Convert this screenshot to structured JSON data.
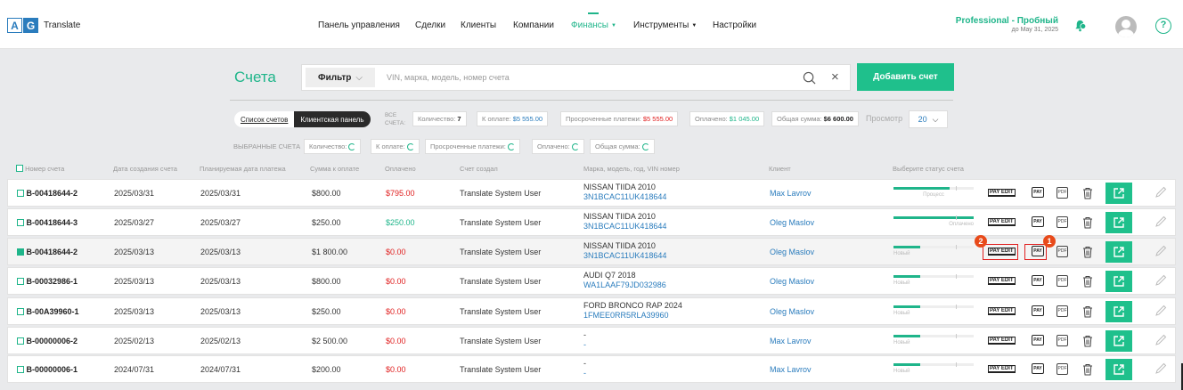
{
  "header": {
    "logo_letters": [
      "A",
      "G"
    ],
    "logo_word": "Translate",
    "nav": [
      {
        "label": "Панель управления",
        "active": false,
        "dropdown": false
      },
      {
        "label": "Сделки",
        "active": false,
        "dropdown": false
      },
      {
        "label": "Клиенты",
        "active": false,
        "dropdown": false
      },
      {
        "label": "Компании",
        "active": false,
        "dropdown": false
      },
      {
        "label": "Финансы",
        "active": true,
        "dropdown": true
      },
      {
        "label": "Инструменты",
        "active": false,
        "dropdown": true
      },
      {
        "label": "Настройки",
        "active": false,
        "dropdown": false
      }
    ],
    "plan_title": "Professional - Пробный",
    "plan_date": "до May 31, 2025",
    "help": "?"
  },
  "toolbar": {
    "title": "Счета",
    "filter_label": "Фильтр",
    "search_placeholder": "VIN, марка, модель, номер счета",
    "add_button": "Добавить счет"
  },
  "summary": {
    "tab_list": "Список счетов",
    "tab_client": "Клиентская панель",
    "all_label_1": "ВСЕ",
    "all_label_2": "СЧЕТА:",
    "count_label": "Количество:",
    "count_value": "7",
    "to_pay_label": "К оплате:",
    "to_pay_value": "$5 555.00",
    "overdue_label": "Просроченные платежи:",
    "overdue_value": "$5 555.00",
    "paid_label": "Оплачено:",
    "paid_value": "$1 045.00",
    "total_label": "Общая сумма:",
    "total_value": "$6 600.00",
    "view_label": "Просмотр",
    "view_value": "20",
    "selected_label": "ВЫБРАННЫЕ СЧЕТА",
    "sel_count": "Количество:",
    "sel_to_pay": "К оплате:",
    "sel_overdue": "Просроченные платежи:",
    "sel_paid": "Оплачено:",
    "sel_total": "Общая сумма:"
  },
  "table": {
    "columns": [
      "Номер счета",
      "Дата создания счета",
      "Планируемая дата платежа",
      "Сумма к оплате",
      "Оплачено",
      "Счет создал",
      "Марка, модель, год, VIN номер",
      "Клиент",
      "Выберите статус счета"
    ],
    "action_labels": {
      "pay_edit": "PAY EDIT",
      "pay": "PAY",
      "pdf": "PDF"
    },
    "rows": [
      {
        "number": "B-00418644-2",
        "created": "2025/03/31",
        "planned": "2025/03/31",
        "amount": "$800.00",
        "paid": "$795.00",
        "paid_color": "red",
        "creator": "Translate System User",
        "car": "NISSAN TIIDA 2010",
        "vin": "3N1BCAC11UK418644",
        "client": "Max Lavrov",
        "status": "Процесс",
        "progress": 0.7,
        "checked": false
      },
      {
        "number": "B-00418644-3",
        "created": "2025/03/27",
        "planned": "2025/03/27",
        "amount": "$250.00",
        "paid": "$250.00",
        "paid_color": "green",
        "creator": "Translate System User",
        "car": "NISSAN TIIDA 2010",
        "vin": "3N1BCAC11UK418644",
        "client": "Oleg Maslov",
        "status": "Оплачено",
        "progress": 1.0,
        "checked": false
      },
      {
        "number": "B-00418644-2",
        "created": "2025/03/13",
        "planned": "2025/03/13",
        "amount": "$1 800.00",
        "paid": "$0.00",
        "paid_color": "red",
        "creator": "Translate System User",
        "car": "NISSAN TIIDA 2010",
        "vin": "3N1BCAC11UK418644",
        "client": "Oleg Maslov",
        "status": "Новый",
        "progress": 0.33,
        "checked": true
      },
      {
        "number": "B-00032986-1",
        "created": "2025/03/13",
        "planned": "2025/03/13",
        "amount": "$800.00",
        "paid": "$0.00",
        "paid_color": "red",
        "creator": "Translate System User",
        "car": "AUDI Q7 2018",
        "vin": "WA1LAAF79JD032986",
        "client": "Oleg Maslov",
        "status": "Новый",
        "progress": 0.33,
        "checked": false
      },
      {
        "number": "B-00A39960-1",
        "created": "2025/03/13",
        "planned": "2025/03/13",
        "amount": "$250.00",
        "paid": "$0.00",
        "paid_color": "red",
        "creator": "Translate System User",
        "car": "FORD BRONCO RAP 2024",
        "vin": "1FMEE0RR5RLA39960",
        "client": "Oleg Maslov",
        "status": "Новый",
        "progress": 0.33,
        "checked": false
      },
      {
        "number": "B-00000006-2",
        "created": "2025/02/13",
        "planned": "2025/02/13",
        "amount": "$2 500.00",
        "paid": "$0.00",
        "paid_color": "red",
        "creator": "Translate System User",
        "car": "-",
        "vin": "-",
        "client": "Max Lavrov",
        "status": "Новый",
        "progress": 0.33,
        "checked": false
      },
      {
        "number": "B-00000006-1",
        "created": "2024/07/31",
        "planned": "2024/07/31",
        "amount": "$200.00",
        "paid": "$0.00",
        "paid_color": "red",
        "creator": "Translate System User",
        "car": "-",
        "vin": "-",
        "client": "Max Lavrov",
        "status": "Новый",
        "progress": 0.33,
        "checked": false
      }
    ]
  },
  "annotations": [
    {
      "label": "2",
      "target": "pay-edit"
    },
    {
      "label": "1",
      "target": "pay"
    }
  ],
  "colors": {
    "accent": "#1fb58a",
    "button": "#1fc08c",
    "link": "#2a7cbd",
    "danger": "#e02020",
    "badge": "#e84a1a"
  }
}
